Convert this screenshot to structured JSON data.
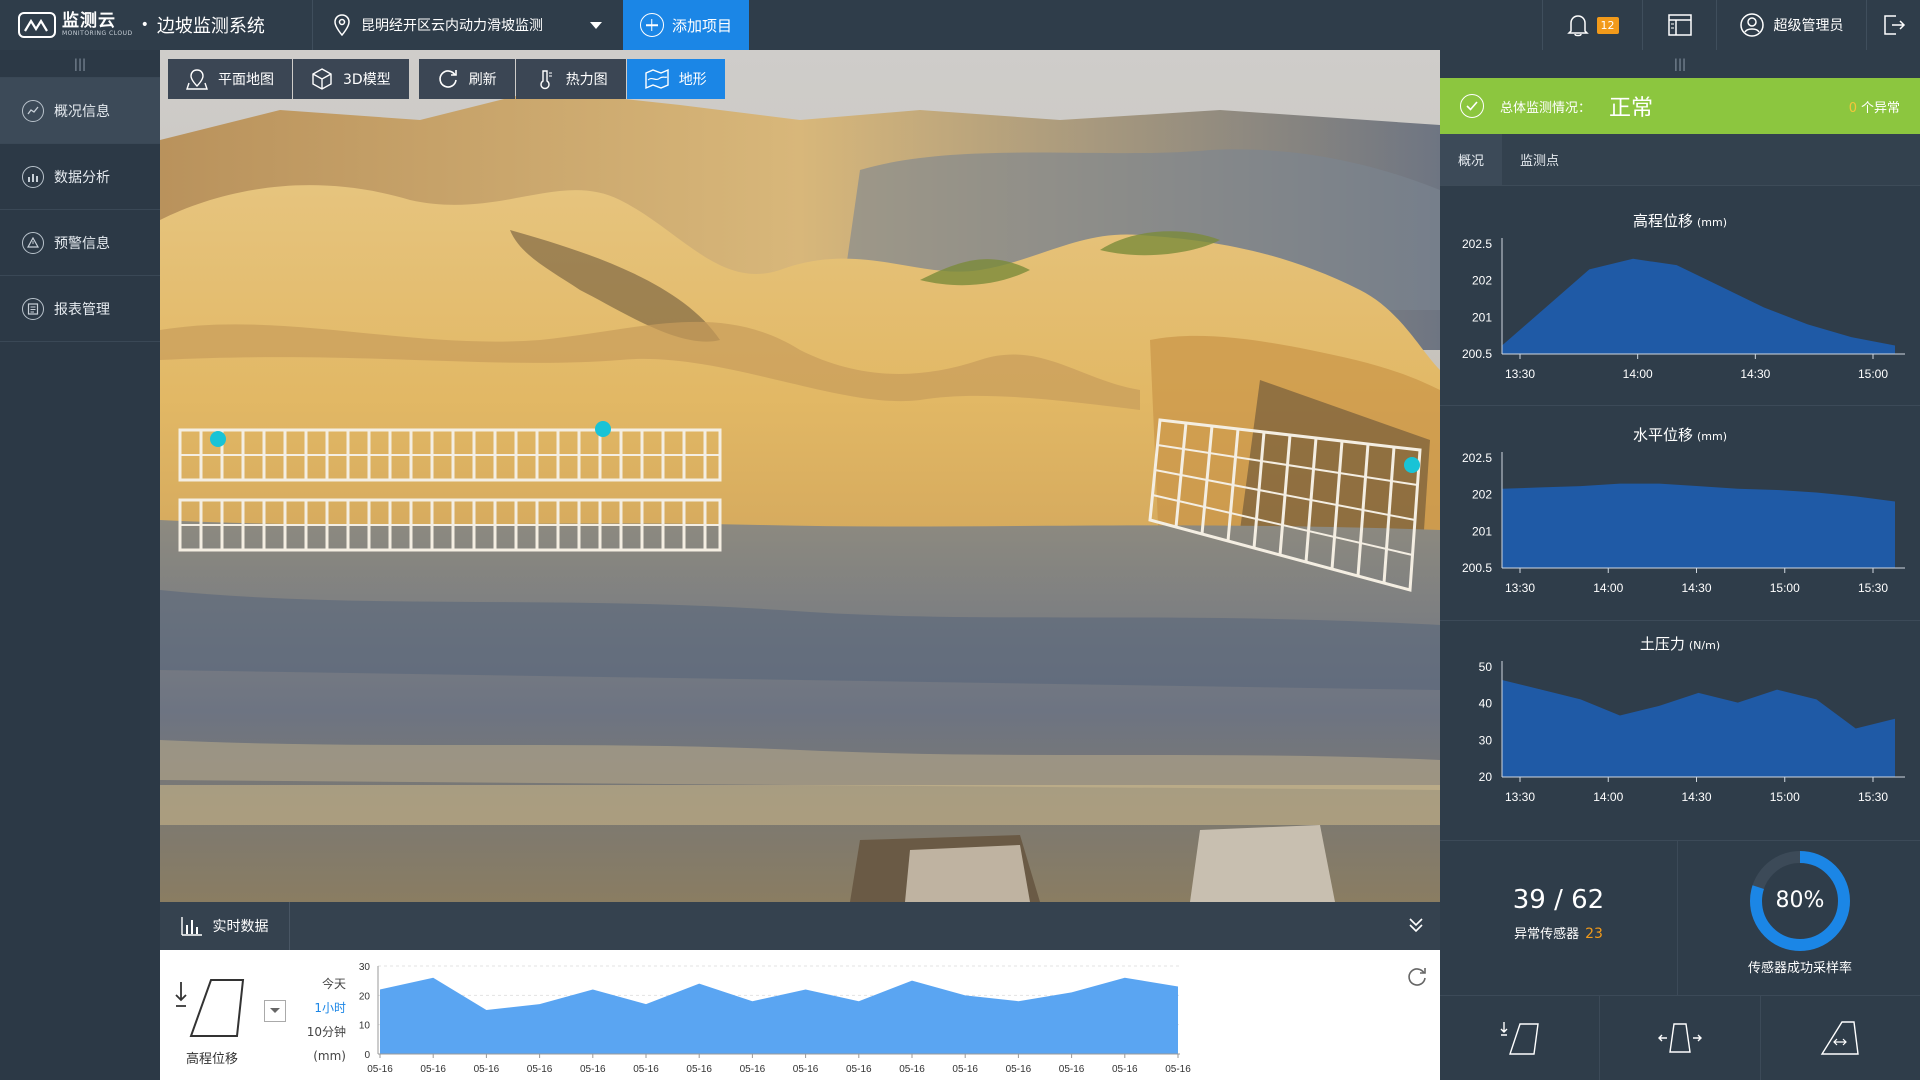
{
  "header": {
    "logo_cn": "监测云",
    "logo_en": "MONITORING CLOUD",
    "separator": "•",
    "app_title": "边坡监测系统",
    "project": "昆明经开区云内动力滑坡监测",
    "add_project": "添加项目",
    "notification_count": "12",
    "user": "超级管理员"
  },
  "sidebar": {
    "grip": "|||",
    "items": [
      {
        "label": "概况信息",
        "icon": "overview-icon"
      },
      {
        "label": "数据分析",
        "icon": "chart-icon"
      },
      {
        "label": "预警信息",
        "icon": "warning-icon"
      },
      {
        "label": "报表管理",
        "icon": "report-icon"
      }
    ]
  },
  "toolbar": {
    "map": "平面地图",
    "model": "3D模型",
    "refresh": "刷新",
    "heatmap": "热力图",
    "terrain": "地形"
  },
  "realtime": {
    "tab": "实时数据",
    "metric": "高程位移",
    "ranges": [
      "今天",
      "1小时",
      "10分钟"
    ],
    "selected_range": "1小时",
    "unit": "(mm)"
  },
  "right_panel": {
    "grip": "|||",
    "status_label": "总体监测情况：",
    "status_value": "正常",
    "abnormal_count": "0",
    "abnormal_suffix": "个异常",
    "tabs": [
      "概况",
      "监测点"
    ],
    "charts": [
      {
        "title": "高程位移",
        "unit": "(mm)",
        "yticks": [
          "202.5",
          "202",
          "201",
          "200.5"
        ],
        "xticks": [
          "13:30",
          "14:00",
          "14:30",
          "15:00"
        ]
      },
      {
        "title": "水平位移",
        "unit": "(mm)",
        "yticks": [
          "202.5",
          "202",
          "201",
          "200.5"
        ],
        "xticks": [
          "13:30",
          "14:00",
          "14:30",
          "15:00",
          "15:30"
        ]
      },
      {
        "title": "土压力",
        "unit": "(N/m)",
        "yticks": [
          "50",
          "40",
          "30",
          "20"
        ],
        "xticks": [
          "13:30",
          "14:00",
          "14:30",
          "15:00",
          "15:30"
        ]
      }
    ],
    "sensors_online": "39 / 62",
    "abnormal_label": "异常传感器",
    "abnormal_sensors": "23",
    "success_rate": "80%",
    "success_rate_value": 0.8,
    "success_label": "传感器成功采样率"
  },
  "colors": {
    "accent": "#1b86e6",
    "status_ok": "#8cc63f",
    "chart_fill": "#1f5aa6",
    "rt_fill": "#5aa5f2"
  },
  "chart_data": [
    {
      "type": "area",
      "title": "高程位移",
      "unit": "(mm)",
      "x": [
        "13:10",
        "13:30",
        "13:45",
        "14:00",
        "14:15",
        "14:30",
        "14:45",
        "15:00",
        "15:15",
        "15:30"
      ],
      "y": [
        200.5,
        201.4,
        202.3,
        202.55,
        202.4,
        201.9,
        201.4,
        201.0,
        200.7,
        200.5
      ],
      "yticks": [
        "202.5",
        "202",
        "201",
        "200.5"
      ],
      "xticks": [
        "13:30",
        "14:00",
        "14:30",
        "15:00"
      ]
    },
    {
      "type": "area",
      "title": "水平位移",
      "unit": "(mm)",
      "x": [
        "13:20",
        "13:30",
        "13:45",
        "14:00",
        "14:15",
        "14:30",
        "14:45",
        "15:00",
        "15:15",
        "15:30",
        "15:40"
      ],
      "y": [
        202.3,
        202.35,
        202.4,
        202.5,
        202.5,
        202.4,
        202.3,
        202.25,
        202.15,
        202.0,
        201.8
      ],
      "yticks": [
        "202.5",
        "202",
        "201",
        "200.5"
      ],
      "xticks": [
        "13:30",
        "14:00",
        "14:30",
        "15:00",
        "15:30"
      ]
    },
    {
      "type": "area",
      "title": "土压力",
      "unit": "(N/m)",
      "x": [
        "13:20",
        "13:30",
        "13:45",
        "14:00",
        "14:15",
        "14:30",
        "14:45",
        "15:00",
        "15:15",
        "15:30",
        "15:40"
      ],
      "y": [
        48,
        45,
        42,
        37,
        40,
        44,
        41,
        45,
        42,
        33,
        36
      ],
      "yticks": [
        "50",
        "40",
        "30",
        "20"
      ],
      "xticks": [
        "13:30",
        "14:00",
        "14:30",
        "15:00",
        "15:30"
      ]
    },
    {
      "type": "area",
      "title": "实时数据 高程位移",
      "unit": "(mm)",
      "x": [
        "05-16",
        "05-16",
        "05-16",
        "05-16",
        "05-16",
        "05-16",
        "05-16",
        "05-16",
        "05-16",
        "05-16",
        "05-16",
        "05-16",
        "05-16",
        "05-16",
        "05-16",
        "05-16"
      ],
      "y": [
        22,
        26,
        15,
        17,
        22,
        17,
        24,
        18,
        22,
        18,
        25,
        20,
        18,
        21,
        26,
        23
      ],
      "yticks": [
        "30",
        "20",
        "10",
        "0"
      ],
      "xticks": [
        "05-16",
        "05-16",
        "05-16",
        "05-16",
        "05-16",
        "05-16",
        "05-16",
        "05-16",
        "05-16",
        "05-16",
        "05-16",
        "05-16",
        "05-16",
        "05-16",
        "05-16",
        "05-16"
      ]
    }
  ]
}
